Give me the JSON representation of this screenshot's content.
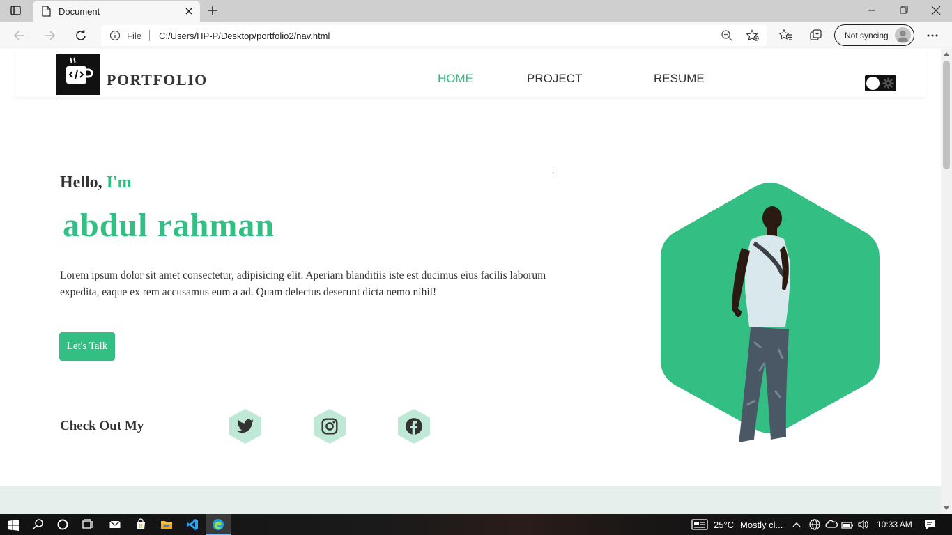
{
  "browser": {
    "tab_title": "Document",
    "address_scheme": "File",
    "url": "C:/Users/HP-P/Desktop/portfolio2/nav.html",
    "profile_status": "Not syncing"
  },
  "page": {
    "logo_text": "PORTFOLIO",
    "nav": {
      "home": "HOME",
      "project": "PROJECT",
      "resume": "RESUME"
    },
    "stray_char": "`",
    "hero": {
      "hello": "Hello,",
      "im": "I'm",
      "name": "abdul rahman",
      "intro": "Lorem ipsum dolor sit amet consectetur, adipisicing elit. Aperiam blanditiis iste est ducimus eius facilis laborum expedita, eaque ex rem accusamus eum a ad. Quam delectus deserunt dicta nemo nihil!",
      "cta": "Let's Talk"
    },
    "social": {
      "heading": "Check Out My",
      "links": [
        "twitter-icon",
        "instagram-icon",
        "facebook-icon"
      ]
    },
    "colors": {
      "accent": "#33bf83",
      "accent_light": "#bfe9d6",
      "text": "#333333",
      "footer_band": "#e6efeb"
    }
  },
  "taskbar": {
    "temperature": "25°C",
    "weather": "Mostly cl...",
    "time": "10:33 AM"
  }
}
